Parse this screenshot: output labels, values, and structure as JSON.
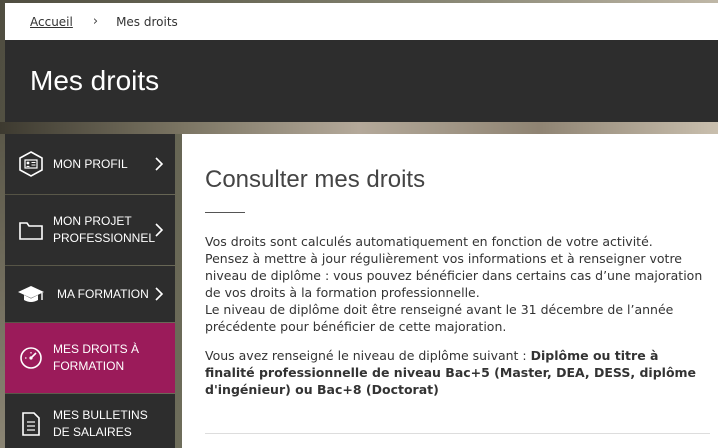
{
  "breadcrumb": {
    "home": "Accueil",
    "separator": "›",
    "current": "Mes droits"
  },
  "header": {
    "title": "Mes droits"
  },
  "sidebar": {
    "items": [
      {
        "label": "MON PROFIL",
        "icon": "id-card-icon",
        "active": false
      },
      {
        "label": "MON PROJET PROFESSIONNEL",
        "icon": "folder-icon",
        "active": false
      },
      {
        "label": "MA FORMATION",
        "icon": "graduation-cap-icon",
        "active": false
      },
      {
        "label": "MES DROITS À FORMATION",
        "icon": "gauge-icon",
        "active": true
      },
      {
        "label": "MES BULLETINS DE SALAIRES",
        "icon": "document-icon",
        "active": false
      }
    ]
  },
  "main": {
    "title": "Consulter mes droits",
    "paragraph1": [
      "Vos droits sont calculés automatiquement en fonction de votre activité.",
      "Pensez à mettre à jour régulièrement vos informations et à renseigner votre niveau de diplôme : vous pouvez bénéficier dans certains cas d’une majoration de vos droits à la formation professionnelle.",
      "Le niveau de diplôme doit être renseigné avant le 31 décembre de l’année précédente pour bénéficier de cette majoration."
    ],
    "paragraph2_prefix": "Vous avez renseigné le niveau de diplôme suivant : ",
    "paragraph2_value": "Diplôme ou titre à finalité professionnelle de niveau Bac+5 (Master, DEA, DESS, diplôme d'ingénieur) ou Bac+8 (Doctorat)"
  },
  "colors": {
    "dark": "#2d2d2d",
    "accent": "#9b1b5a",
    "white": "#ffffff"
  }
}
